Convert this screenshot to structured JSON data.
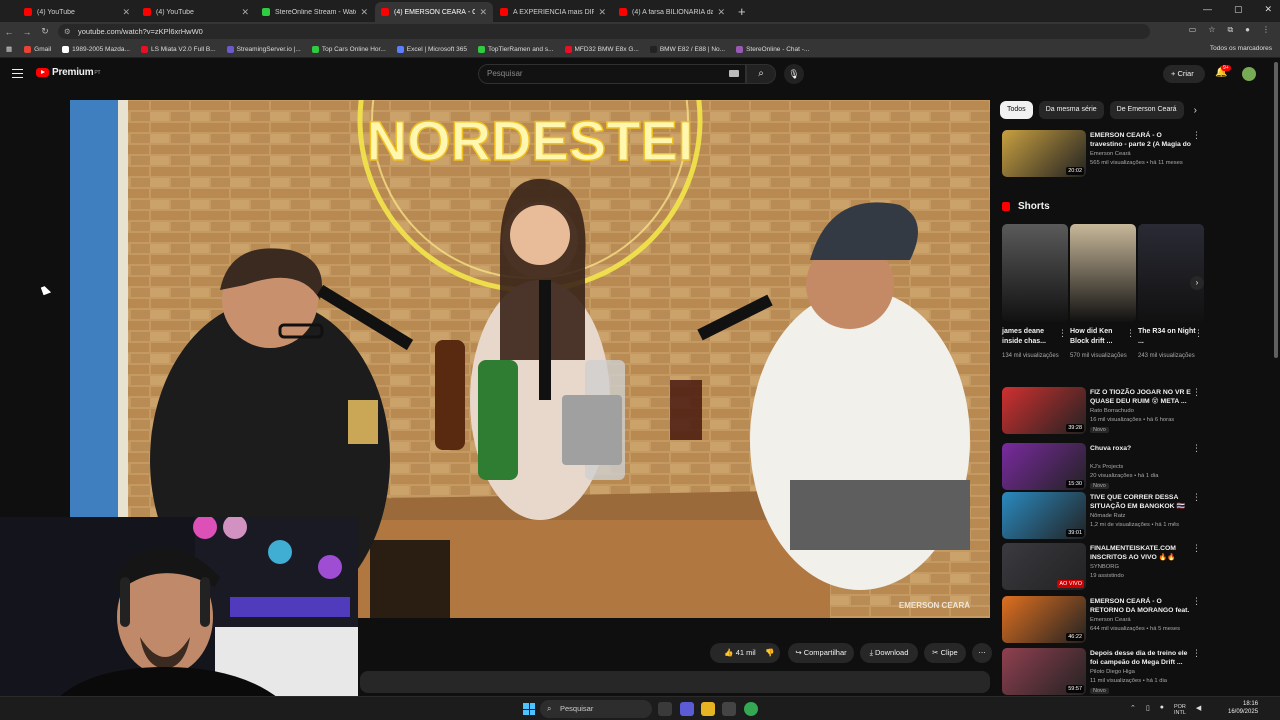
{
  "browser": {
    "tabs": [
      {
        "title": "(4) YouTube",
        "active": false,
        "fav": "red"
      },
      {
        "title": "(4) YouTube",
        "active": false,
        "fav": "red"
      },
      {
        "title": "StereOnline Stream - Watch Liv",
        "active": false,
        "fav": "green"
      },
      {
        "title": "(4) EMERSON CEARÁ - O tr",
        "active": true,
        "fav": "red"
      },
      {
        "title": "A EXPERIÊNCIA mais DIFERENTE",
        "active": false,
        "fav": "red"
      },
      {
        "title": "(4) A farsa BILIONÁRIA das ma",
        "active": false,
        "fav": "red"
      }
    ],
    "url": "youtube.com/watch?v=zKPl6xrHwW0",
    "bookmarks": [
      {
        "label": "Gmail",
        "color": "#ea4335"
      },
      {
        "label": "1989-2005 Mazda...",
        "color": "#ffffff"
      },
      {
        "label": "LS Miata V2.0 Full B...",
        "color": "#e81123"
      },
      {
        "label": "StreamingServer.io |...",
        "color": "#6a5acd"
      },
      {
        "label": "Top Cars Online Hor...",
        "color": "#2ecc40"
      },
      {
        "label": "Excel | Microsoft 365",
        "color": "#5b7fff"
      },
      {
        "label": "TopTierRamen and s...",
        "color": "#2ecc40"
      },
      {
        "label": "MFD32 BMW E8x G...",
        "color": "#e81123"
      },
      {
        "label": "BMW E82 / E88 | No...",
        "color": "#222222"
      },
      {
        "label": "StereOnline - Chat -...",
        "color": "#9b59b6"
      }
    ],
    "bookmarks_folder": "Todos os marcadores"
  },
  "youtube": {
    "logo": "Premium",
    "logo_sup": "PT",
    "search_placeholder": "Pesquisar",
    "create_label": "Criar",
    "notif_count": "9+"
  },
  "video": {
    "sign_text": "NORDESTEI",
    "watermark": "EMERSON CEARÁ"
  },
  "actions": {
    "likes": "41 mil",
    "share": "Compartilhar",
    "download": "Download",
    "clip": "Clipe"
  },
  "sidebar": {
    "chips": [
      "Todos",
      "Da mesma série",
      "De Emerson Ceará"
    ],
    "first": {
      "title": "EMERSON CEARÁ - O travestino - parte 2 (A Magia do Boteco)",
      "channel": "Emerson Ceará",
      "meta": "565 mil visualizações • há 11 meses",
      "duration": "20:02",
      "thumb": "#c8a040"
    },
    "shorts_header": "Shorts",
    "shorts": [
      {
        "title": "james deane inside chas...",
        "views": "134 mil visualizações",
        "color": "#5a5a5a"
      },
      {
        "title": "How did Ken Block drift ...",
        "views": "570 mil visualizações",
        "color": "#c8b89a"
      },
      {
        "title": "The R34 on Night ...",
        "views": "243 mil visualizações",
        "color": "#2a2a35"
      }
    ],
    "videos": [
      {
        "title": "FIZ O TIOZÃO JOGAR NO VR E QUASE DEU RUIM 😵 META ...",
        "channel": "Rato Borrachudo",
        "meta": "16 mil visualizações • há 6 horas",
        "badge": "Novo",
        "duration": "39:28",
        "thumb": "#d03030"
      },
      {
        "title": "Chuva roxa?",
        "channel": "KJ's Projects",
        "meta": "20 visualizações • há 1 dia",
        "badge": "Novo",
        "duration": "15:30",
        "thumb": "#7a2aa0"
      },
      {
        "title": "TIVE QUE CORRER DESSA SITUAÇÃO EM BANGKOK 🇹🇭",
        "channel": "Nômade Ratz",
        "meta": "1,2 mi de visualizações • há 1 mês",
        "badge": "",
        "duration": "39:01",
        "thumb": "#2a8ac0"
      },
      {
        "title": "FINALMENTEISKATE.COM INSCRITOS AO VIVO 🔥🔥",
        "channel": "SYNBORG",
        "meta": "19 assistindo",
        "badge": "",
        "duration": "",
        "live": "AO VIVO",
        "thumb": "#3a3a40"
      },
      {
        "title": "EMERSON CEARÁ - O RETORNO DA MORANGO feat. Felipe Mosk",
        "channel": "Emerson Ceará",
        "meta": "644 mil visualizações • há 5 meses",
        "badge": "",
        "duration": "46:22",
        "thumb": "#e07020"
      },
      {
        "title": "Depois desse dia de treino ele foi campeão do Mega Drift ...",
        "channel": "Piloto Diego Higa",
        "meta": "11 mil visualizações • há 1 dia",
        "badge": "Novo",
        "duration": "59:57",
        "thumb": "#904050"
      }
    ]
  },
  "taskbar": {
    "search": "Pesquisar",
    "lang1": "POR",
    "lang2": "INTL",
    "time": "18:16",
    "date": "16/09/2025"
  }
}
